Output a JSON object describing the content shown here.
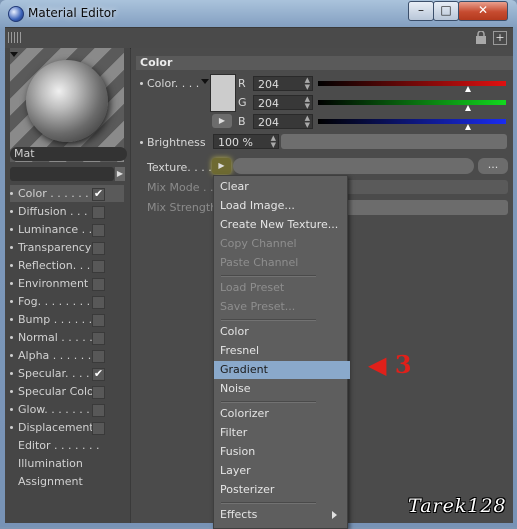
{
  "window": {
    "title": "Material Editor",
    "minimize_glyph": "–",
    "maximize_glyph": "□",
    "close_glyph": "✕"
  },
  "material": {
    "name": "Mat"
  },
  "channels": [
    {
      "label": "Color . . . . . .",
      "checked": true,
      "selected": true,
      "dot": true
    },
    {
      "label": "Diffusion . . . . .",
      "checked": false,
      "dot": true
    },
    {
      "label": "Luminance . . . .",
      "checked": false,
      "dot": true
    },
    {
      "label": "Transparency",
      "checked": false,
      "dot": true
    },
    {
      "label": "Reflection. . . . .",
      "checked": false,
      "dot": true
    },
    {
      "label": "Environment",
      "checked": false,
      "dot": true
    },
    {
      "label": "Fog. . . . . . . . .",
      "checked": false,
      "dot": true
    },
    {
      "label": "Bump . . . . . . .",
      "checked": false,
      "dot": true
    },
    {
      "label": "Normal . . . . . .",
      "checked": false,
      "dot": true
    },
    {
      "label": "Alpha . . . . . . .",
      "checked": false,
      "dot": true
    },
    {
      "label": "Specular. . . . .",
      "checked": true,
      "dot": true
    },
    {
      "label": "Specular Color",
      "checked": false,
      "dot": true
    },
    {
      "label": "Glow. . . . . . . .",
      "checked": false,
      "dot": true
    },
    {
      "label": "Displacement",
      "checked": false,
      "dot": true
    },
    {
      "label": "Editor . . . . . . .",
      "checked": null,
      "dot": false
    },
    {
      "label": "Illumination",
      "checked": null,
      "dot": false
    },
    {
      "label": "Assignment",
      "checked": null,
      "dot": false
    }
  ],
  "color_section": {
    "header": "Color",
    "color_label": "Color. . . .",
    "swatch_color": "#cccccc",
    "r_label": "R",
    "r_value": "204",
    "g_label": "G",
    "g_value": "204",
    "b_label": "B",
    "b_value": "204",
    "level_fraction": 0.8,
    "brightness_label": "Brightness",
    "brightness_value": "100 %",
    "texture_label": "Texture. . . .",
    "texture_dots": "...",
    "mix_mode_label": "Mix Mode . .",
    "mix_strength_label": "Mix Strength"
  },
  "texture_menu": {
    "items": [
      {
        "label": "Clear",
        "enabled": true
      },
      {
        "label": "Load Image...",
        "enabled": true
      },
      {
        "label": "Create New Texture...",
        "enabled": true
      },
      {
        "label": "Copy Channel",
        "enabled": false
      },
      {
        "label": "Paste Channel",
        "enabled": false
      },
      {
        "sep": true
      },
      {
        "label": "Load Preset",
        "enabled": false
      },
      {
        "label": "Save Preset...",
        "enabled": false
      },
      {
        "sep": true
      },
      {
        "label": "Color",
        "enabled": true
      },
      {
        "label": "Fresnel",
        "enabled": true
      },
      {
        "label": "Gradient",
        "enabled": true,
        "highlighted": true
      },
      {
        "label": "Noise",
        "enabled": true
      },
      {
        "sep": true
      },
      {
        "label": "Colorizer",
        "enabled": true
      },
      {
        "label": "Filter",
        "enabled": true
      },
      {
        "label": "Fusion",
        "enabled": true
      },
      {
        "label": "Layer",
        "enabled": true
      },
      {
        "label": "Posterizer",
        "enabled": true
      },
      {
        "sep": true
      },
      {
        "label": "Effects",
        "enabled": true,
        "submenu": true
      }
    ]
  },
  "annotation": {
    "text": "◀ 3",
    "color": "#e0201a"
  },
  "signature": "Tarek128"
}
